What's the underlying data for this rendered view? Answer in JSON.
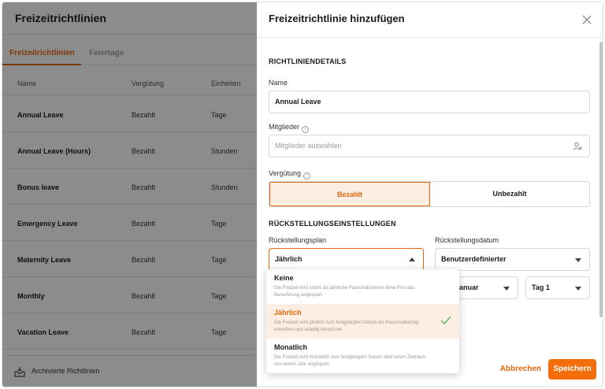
{
  "left": {
    "title": "Freizeitrichtlinien",
    "tabs": [
      "Freizeitrichtlinien",
      "Feiertage"
    ],
    "columns": [
      "Name",
      "Vergütung",
      "Einheiten"
    ],
    "rows": [
      {
        "name": "Annual Leave",
        "pay": "Bezahlt",
        "unit": "Tage"
      },
      {
        "name": "Annual Leave (Hours)",
        "pay": "Bezahlt",
        "unit": "Stunden"
      },
      {
        "name": "Bonus leave",
        "pay": "Bezahlt",
        "unit": "Stunden"
      },
      {
        "name": "Emergency Leave",
        "pay": "Bezahlt",
        "unit": "Tage"
      },
      {
        "name": "Maternity Leave",
        "pay": "Bezahlt",
        "unit": "Tage"
      },
      {
        "name": "Monthly",
        "pay": "Bezahlt",
        "unit": "Tage"
      },
      {
        "name": "Vacation Leave",
        "pay": "Bezahlt",
        "unit": "Tage"
      }
    ],
    "archived_label": "Archivierte Richtlinien"
  },
  "panel": {
    "title": "Freizeitrichtlinie hinzufügen",
    "section_details": "RICHTLINIENDETAILS",
    "name_label": "Name",
    "name_value": "Annual Leave",
    "members_label": "Mitglieder",
    "members_placeholder": "Mitglieder auswählen",
    "pay_label": "Vergütung",
    "pay_options": [
      "Bezahlt",
      "Unbezahlt"
    ],
    "section_accrual": "RÜCKSTELLUNGSEINSTELLUNGEN",
    "plan_label": "Rückstellungsplan",
    "plan_value": "Jährlich",
    "date_label": "Rückstellungsdatum",
    "date_value": "Benutzerdefinierter",
    "month_value": "Januar",
    "day_value": "Tag 1",
    "cancel_label": "Abbrechen",
    "save_label": "Speichern"
  },
  "dropdown": {
    "options": [
      {
        "title": "Keine",
        "desc": "Die Freizeit wird sofort als jährliche Pauschalsumme ohne Pro-rata-Berechnung angespart."
      },
      {
        "title": "Jährlich",
        "desc": "Die Freizeit wird jährlich zum festgelegten Datum als Pauschalbetrag erworben und anteilig berechnet."
      },
      {
        "title": "Monatlich",
        "desc": "Die Freizeit wird monatlich zum festgelegten Datum über einen Zeitraum von einem Jahr angespart."
      }
    ],
    "selected_index": 1
  },
  "colors": {
    "accent": "#e8660d",
    "accent_bg": "#fdeee3"
  }
}
